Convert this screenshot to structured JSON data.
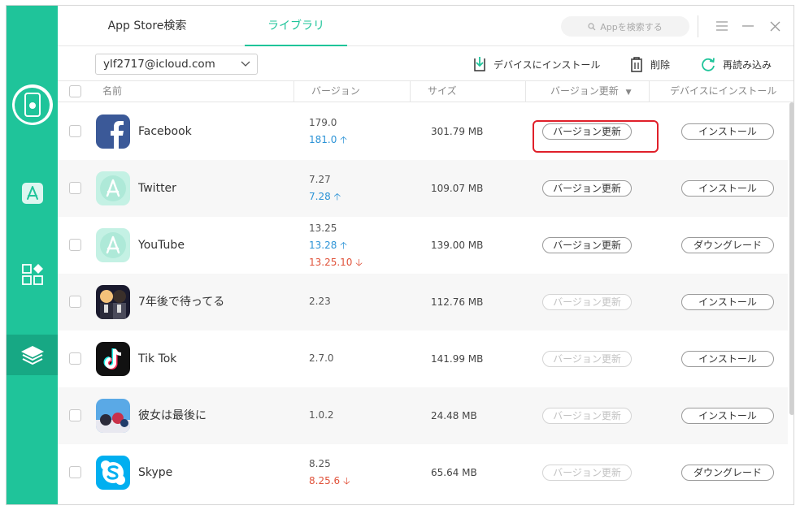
{
  "tabs": {
    "store": "App Store検索",
    "library": "ライブラリ"
  },
  "search": {
    "placeholder": "Appを検索する"
  },
  "account": {
    "email": "ylf2717@icloud.com"
  },
  "toolbar": {
    "install": "デバイスにインストール",
    "delete": "削除",
    "reload": "再読み込み"
  },
  "table": {
    "headers": {
      "name": "名前",
      "version": "バージョン",
      "size": "サイズ",
      "update": "バージョン更新",
      "install": "デバイスにインストール"
    }
  },
  "rows": [
    {
      "name": "Facebook",
      "v1": "179.0",
      "v2": "181.0",
      "size": "301.79 MB",
      "update": "バージョン更新",
      "action": "インストール"
    },
    {
      "name": "Twitter",
      "v1": "7.27",
      "v2": "7.28",
      "size": "109.07 MB",
      "update": "バージョン更新",
      "action": "インストール"
    },
    {
      "name": "YouTube",
      "v1": "13.25",
      "v2": "13.28",
      "v3": "13.25.10",
      "size": "139.00 MB",
      "update": "バージョン更新",
      "action": "ダウングレード"
    },
    {
      "name": "7年後で待ってる",
      "v1": "2.23",
      "size": "112.76 MB",
      "update": "バージョン更新",
      "action": "インストール"
    },
    {
      "name": "Tik Tok",
      "v1": "2.7.0",
      "size": "141.99 MB",
      "update": "バージョン更新",
      "action": "インストール"
    },
    {
      "name": "彼女は最後に",
      "v1": "1.0.2",
      "size": "24.48 MB",
      "update": "バージョン更新",
      "action": "インストール"
    },
    {
      "name": "Skype",
      "v1": "8.25",
      "v3": "8.25.6",
      "size": "65.64 MB",
      "update": "バージョン更新",
      "action": "ダウングレード"
    }
  ],
  "colors": {
    "accent": "#1fc49a",
    "up": "#2c93d6",
    "down": "#e0523a",
    "highlight": "#e0202a"
  }
}
